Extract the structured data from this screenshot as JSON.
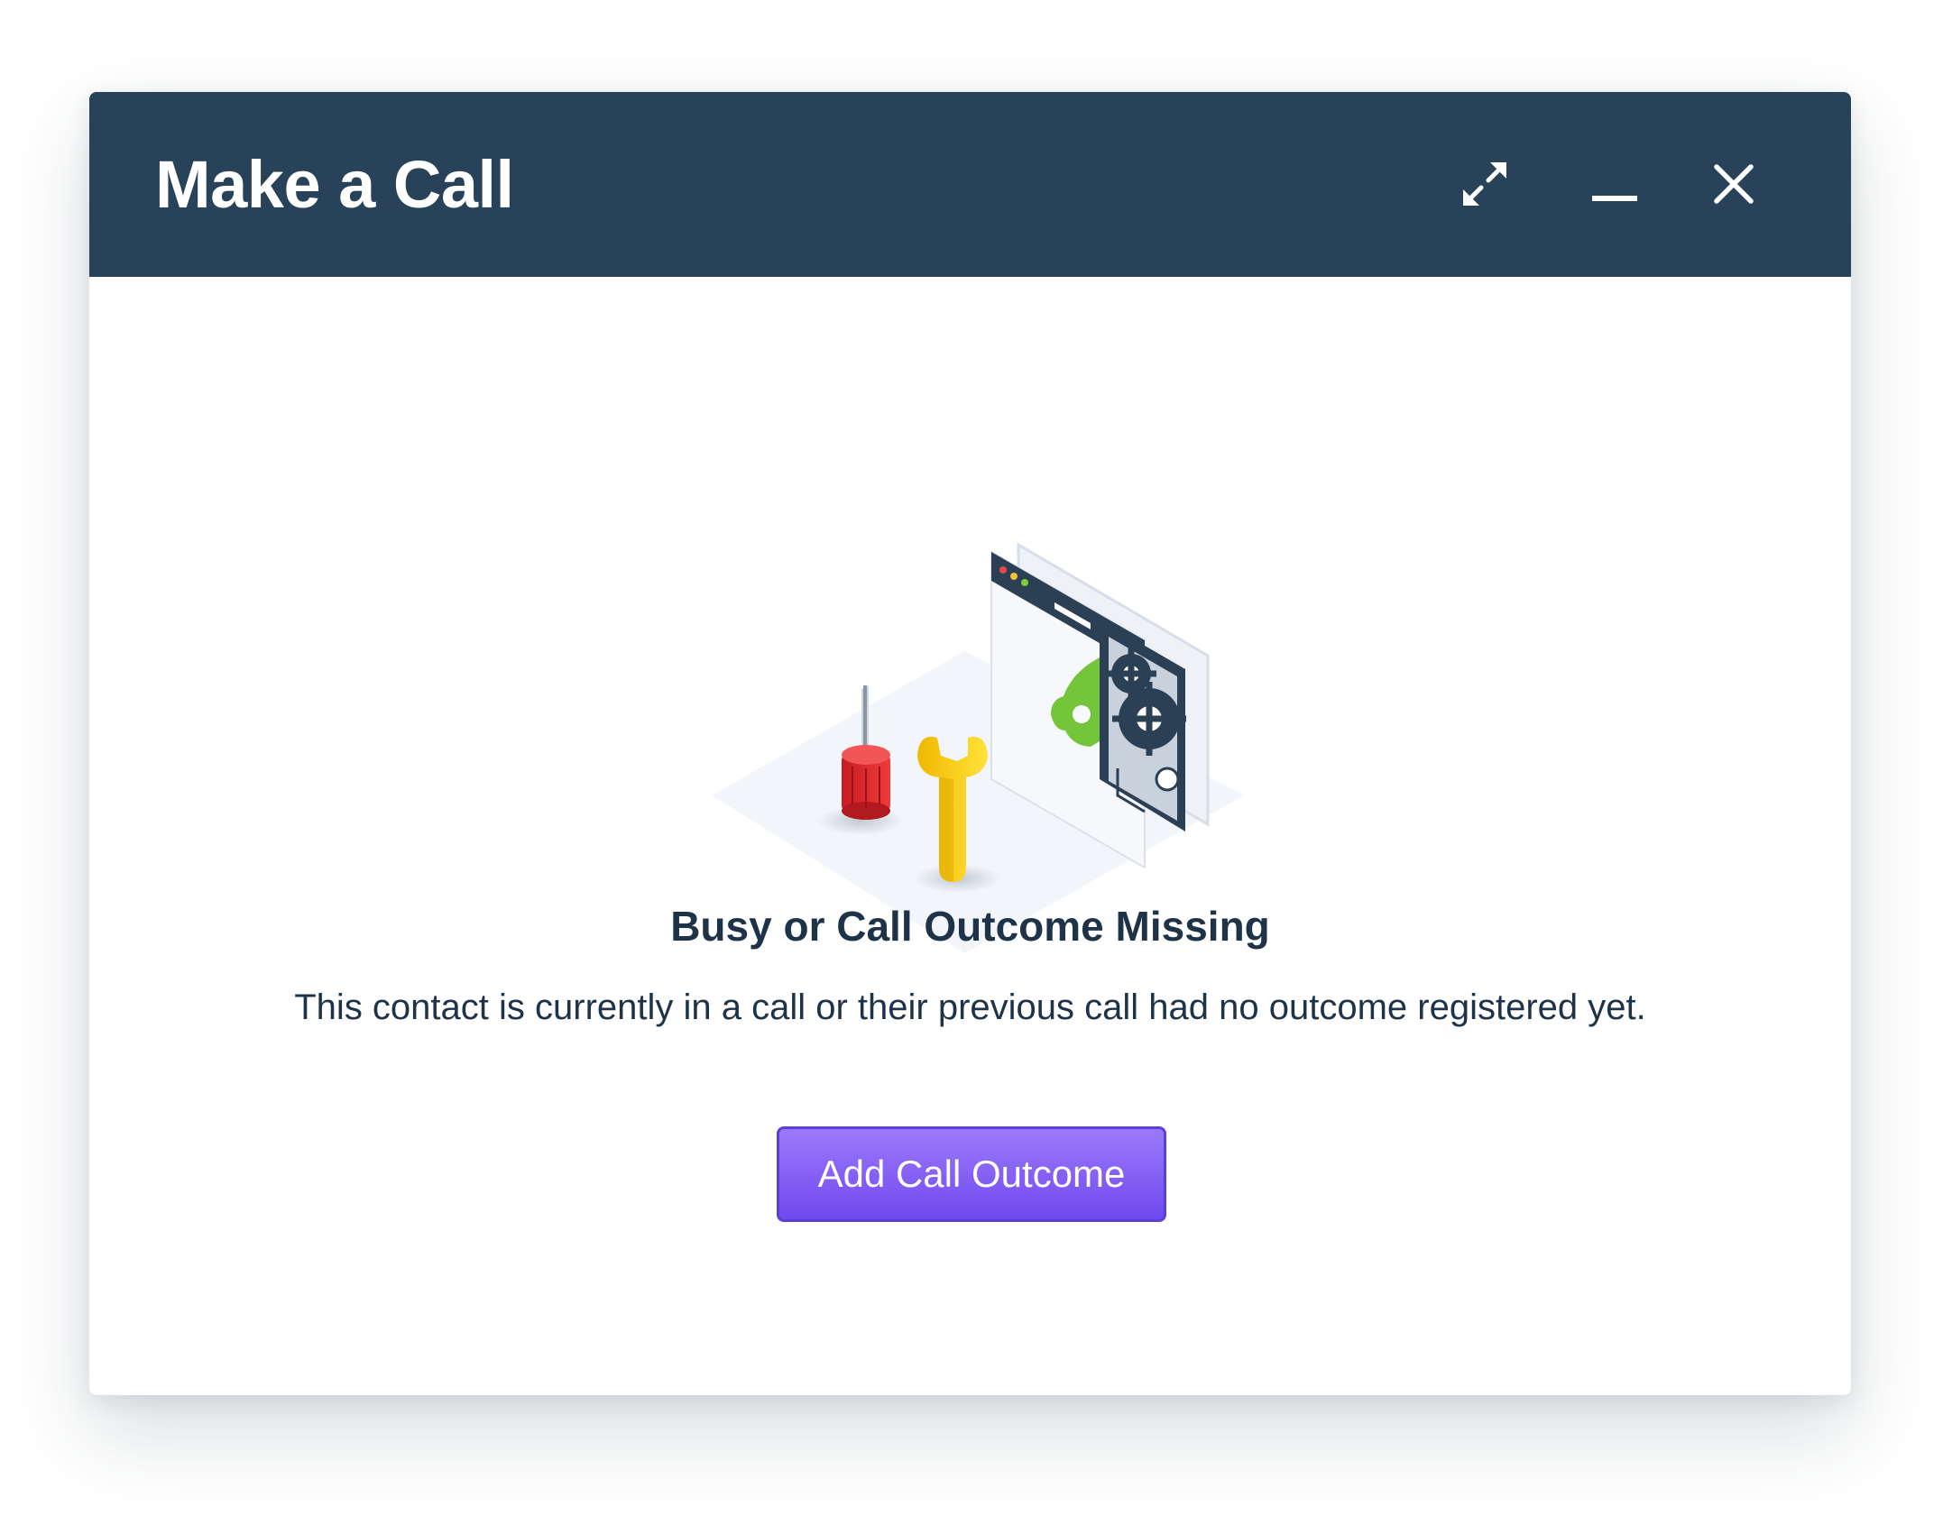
{
  "dialog": {
    "title": "Make a Call",
    "controls": {
      "expand_icon": "expand-arrows-icon",
      "minimize_icon": "minimize-dash-icon",
      "close_icon": "close-x-icon"
    }
  },
  "empty_state": {
    "illustration": "maintenance-tools-illustration",
    "heading": "Busy or Call Outcome Missing",
    "message": "This contact is currently in a call or their previous call had no outcome registered yet.",
    "action_label": "Add Call Outcome"
  },
  "colors": {
    "header_bg": "#284259",
    "text": "#1e3347",
    "accent": "#7149ee",
    "accent_border": "#5a3fd8"
  }
}
